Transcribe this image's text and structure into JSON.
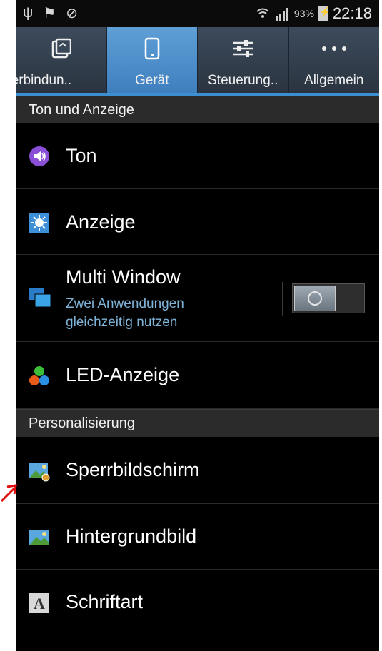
{
  "status": {
    "battery_percent": "93%",
    "time": "22:18",
    "icons_left": [
      "usb-icon",
      "flag-icon",
      "sync-icon"
    ],
    "icons_right": [
      "wifi-icon",
      "signal-icon",
      "battery-icon"
    ]
  },
  "tabs": [
    {
      "label": "Verbindun..",
      "icon": "connections-icon",
      "active": false
    },
    {
      "label": "Gerät",
      "icon": "phone-icon",
      "active": true
    },
    {
      "label": "Steuerung..",
      "icon": "sliders-icon",
      "active": false
    },
    {
      "label": "Allgemein",
      "icon": "more-icon",
      "active": false
    }
  ],
  "sections": {
    "sound_display": "Ton und Anzeige",
    "personalization": "Personalisierung"
  },
  "items": {
    "ton": {
      "label": "Ton"
    },
    "anzeige": {
      "label": "Anzeige"
    },
    "multi_window": {
      "label": "Multi Window",
      "subtitle": "Zwei Anwendungen gleichzeitig nutzen",
      "enabled": false
    },
    "led": {
      "label": "LED-Anzeige"
    },
    "sperrbildschirm": {
      "label": "Sperrbildschirm"
    },
    "hintergrundbild": {
      "label": "Hintergrundbild"
    },
    "schriftart": {
      "label": "Schriftart"
    }
  },
  "colors": {
    "tab_active": "#4f90cf",
    "accent_line": "#3b8fd0",
    "subtitle": "#7fb3d8",
    "annotation_arrow": "#e01010"
  }
}
